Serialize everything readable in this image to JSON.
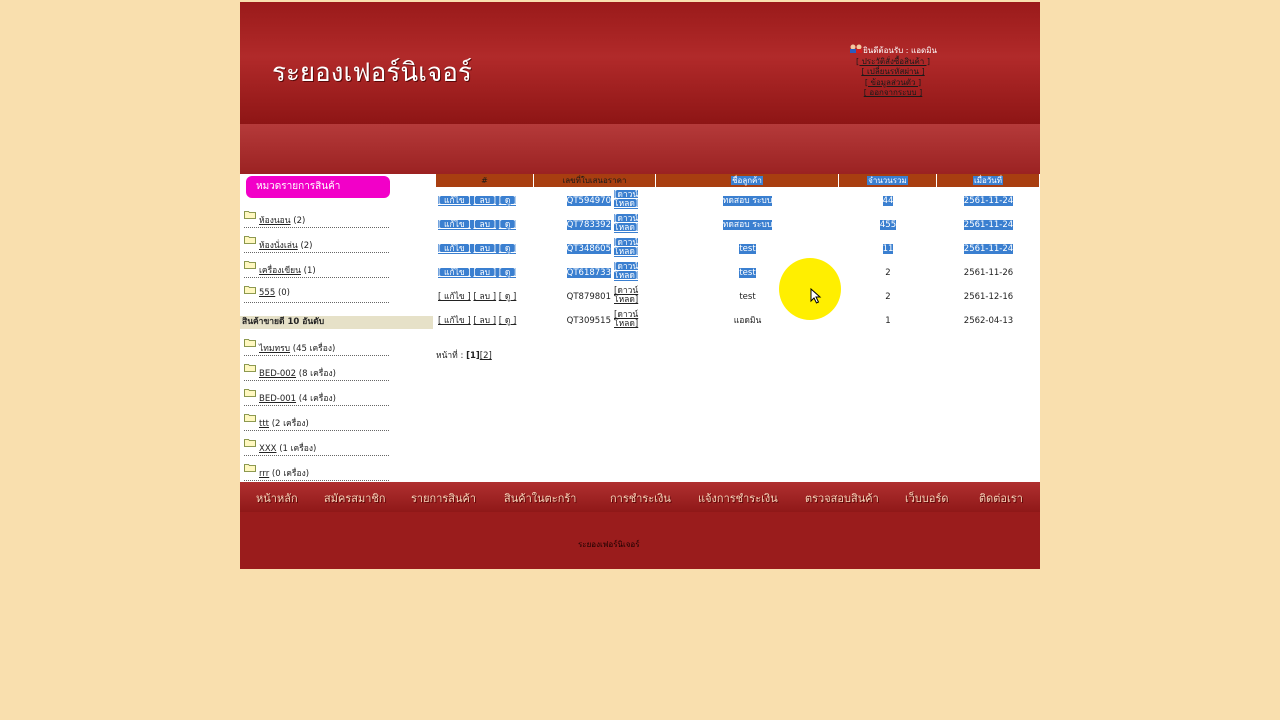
{
  "site": {
    "logo": "ระยองเฟอร์นิเจอร์"
  },
  "user_box": {
    "welcome": "ยินดีต้อนรับ : แอดมิน",
    "links": [
      "[ ประวัติสั่งซื้อสินค้า ]",
      "[ เปลี่ยนรหัสผ่าน ]",
      "[ ข้อมูลส่วนตัว ]",
      "[ ออกจากระบบ ]"
    ]
  },
  "sidebar": {
    "category_header": "หมวดรายการสินค้า",
    "categories": [
      {
        "name": "ห้องนอน",
        "count": "(2)"
      },
      {
        "name": "ห้องนั่งเล่น",
        "count": "(2)"
      },
      {
        "name": "เครื่องเขียน",
        "count": "(1)"
      },
      {
        "name": "555",
        "count": "(0)"
      }
    ],
    "best_header": "สินค้าขายดี 10 อันดับ",
    "best": [
      {
        "name": "ไทมทรบ",
        "count": "(45 เครื่อง)"
      },
      {
        "name": "BED-002",
        "count": "(8 เครื่อง)"
      },
      {
        "name": "BED-001",
        "count": "(4 เครื่อง)"
      },
      {
        "name": "ttt",
        "count": "(2 เครื่อง)"
      },
      {
        "name": "XXX",
        "count": "(1 เครื่อง)"
      },
      {
        "name": "rrr",
        "count": "(0 เครื่อง)"
      }
    ]
  },
  "table": {
    "headers": [
      "#",
      "เลขที่ใบเสนอราคา",
      "ชื่อลูกค้า",
      "จำนวนรวม",
      "เมื่อวันที่"
    ],
    "actions": {
      "edit": "[ แก้ไข ]",
      "delete": "[ ลบ ]",
      "view": "[ ดู ]",
      "download_1": "[ดาวน์",
      "download_2": "โหลด]"
    },
    "rows": [
      {
        "quote": "QT594970",
        "customer": "ทดสอบ ระบบ",
        "qty": "44",
        "date": "2561-11-24"
      },
      {
        "quote": "QT783392",
        "customer": "ทดสอบ ระบบ",
        "qty": "455",
        "date": "2561-11-24"
      },
      {
        "quote": "QT348605",
        "customer": "test",
        "qty": "11",
        "date": "2561-11-24"
      },
      {
        "quote": "QT618733",
        "customer": "test",
        "qty": "2",
        "date": "2561-11-26"
      },
      {
        "quote": "QT879801",
        "customer": "test",
        "qty": "2",
        "date": "2561-12-16"
      },
      {
        "quote": "QT309515",
        "customer": "แอดมิน",
        "qty": "1",
        "date": "2562-04-13"
      }
    ]
  },
  "pager": {
    "label": "หน้าที่ :",
    "current": "[1]",
    "next": "[2]"
  },
  "nav": [
    "หน้าหลัก",
    "สมัครสมาชิก",
    "รายการสินค้า",
    "สินค้าในตะกร้า",
    "การชำระเงิน",
    "แจ้งการชำระเงิน",
    "ตรวจสอบสินค้า",
    "เว็บบอร์ด",
    "ติดต่อเรา"
  ],
  "footer": {
    "copyright": "ระยองเฟอร์นิเจอร์"
  },
  "colors": {
    "header": "#9a1a1a",
    "category": "#f200c8",
    "selection": "#3a7fd0",
    "table_header": "#a83e10",
    "background": "#f9dfae"
  }
}
